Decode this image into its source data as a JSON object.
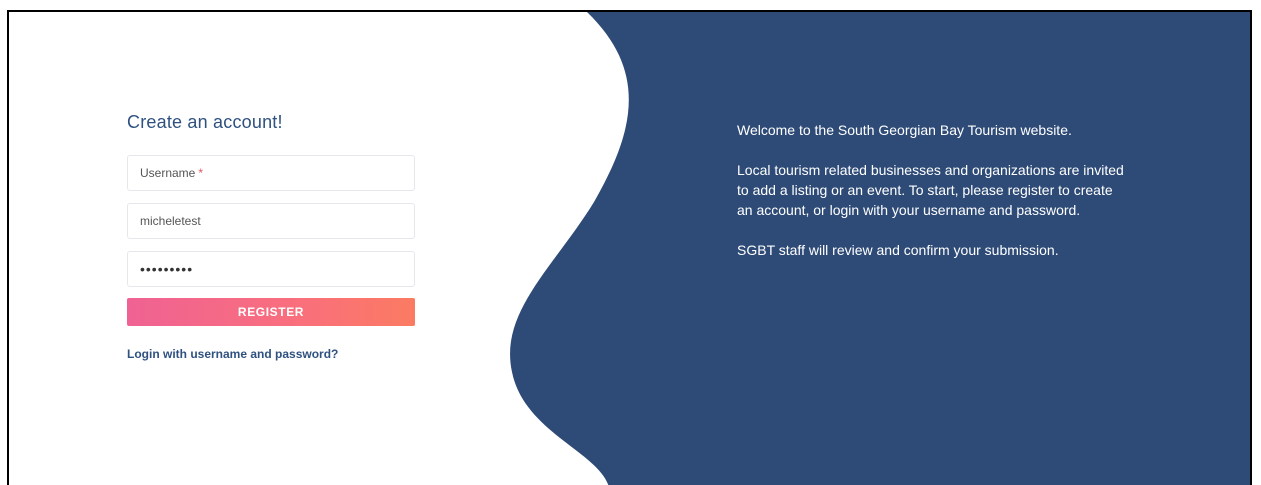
{
  "form": {
    "title": "Create an account!",
    "username_label": "Username",
    "required_mark": "*",
    "second_field_value": "micheletest",
    "password_value": "•••••••••",
    "register_label": "REGISTER",
    "login_link": "Login with username and password?"
  },
  "info": {
    "paragraphs": [
      "Welcome to the South Georgian Bay Tourism website.",
      "Local tourism related businesses and organizations are invited to add a listing or an event. To start, please register to create an account, or login with your username and password.",
      "SGBT staff will review and confirm your submission."
    ]
  },
  "colors": {
    "panel": "#2e4b77",
    "accent_text": "#2f5180",
    "button_start": "#ef6293",
    "button_end": "#fb7b62"
  }
}
